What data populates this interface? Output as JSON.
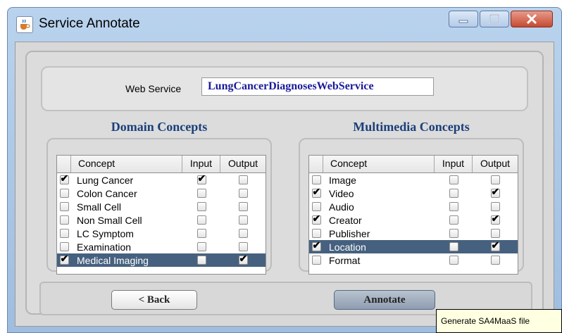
{
  "window": {
    "title": "Service Annotate",
    "icon": "java-cup-icon"
  },
  "web_service": {
    "label": "Web Service",
    "value": "LungCancerDiagnosesWebService"
  },
  "domain": {
    "title": "Domain Concepts",
    "headers": [
      "Concept",
      "Input",
      "Output"
    ],
    "rows": [
      {
        "concept": "Lung Cancer",
        "selected_cb": true,
        "input": true,
        "output": false,
        "highlight": false
      },
      {
        "concept": "Colon Cancer",
        "selected_cb": false,
        "input": false,
        "output": false,
        "highlight": false
      },
      {
        "concept": "Small Cell",
        "selected_cb": false,
        "input": false,
        "output": false,
        "highlight": false
      },
      {
        "concept": "Non Small Cell",
        "selected_cb": false,
        "input": false,
        "output": false,
        "highlight": false
      },
      {
        "concept": "LC Symptom",
        "selected_cb": false,
        "input": false,
        "output": false,
        "highlight": false
      },
      {
        "concept": "Examination",
        "selected_cb": false,
        "input": false,
        "output": false,
        "highlight": false
      },
      {
        "concept": "Medical Imaging",
        "selected_cb": true,
        "input": false,
        "output": true,
        "highlight": true
      }
    ]
  },
  "multimedia": {
    "title": "Multimedia Concepts",
    "headers": [
      "Concept",
      "Input",
      "Output"
    ],
    "rows": [
      {
        "concept": "Image",
        "selected_cb": false,
        "input": false,
        "output": false,
        "highlight": false
      },
      {
        "concept": "Video",
        "selected_cb": true,
        "input": false,
        "output": true,
        "highlight": false
      },
      {
        "concept": "Audio",
        "selected_cb": false,
        "input": false,
        "output": false,
        "highlight": false
      },
      {
        "concept": "Creator",
        "selected_cb": true,
        "input": false,
        "output": true,
        "highlight": false
      },
      {
        "concept": "Publisher",
        "selected_cb": false,
        "input": false,
        "output": false,
        "highlight": false
      },
      {
        "concept": "Location",
        "selected_cb": true,
        "input": false,
        "output": true,
        "highlight": true
      },
      {
        "concept": "Format",
        "selected_cb": false,
        "input": false,
        "output": false,
        "highlight": false
      }
    ]
  },
  "buttons": {
    "back": "< Back",
    "annotate": "Annotate"
  },
  "tooltip": "Generate SA4MaaS file",
  "colors": {
    "selection": "#46617f",
    "title_text": "#1b3f7a",
    "value_text": "#1a1a9a"
  }
}
